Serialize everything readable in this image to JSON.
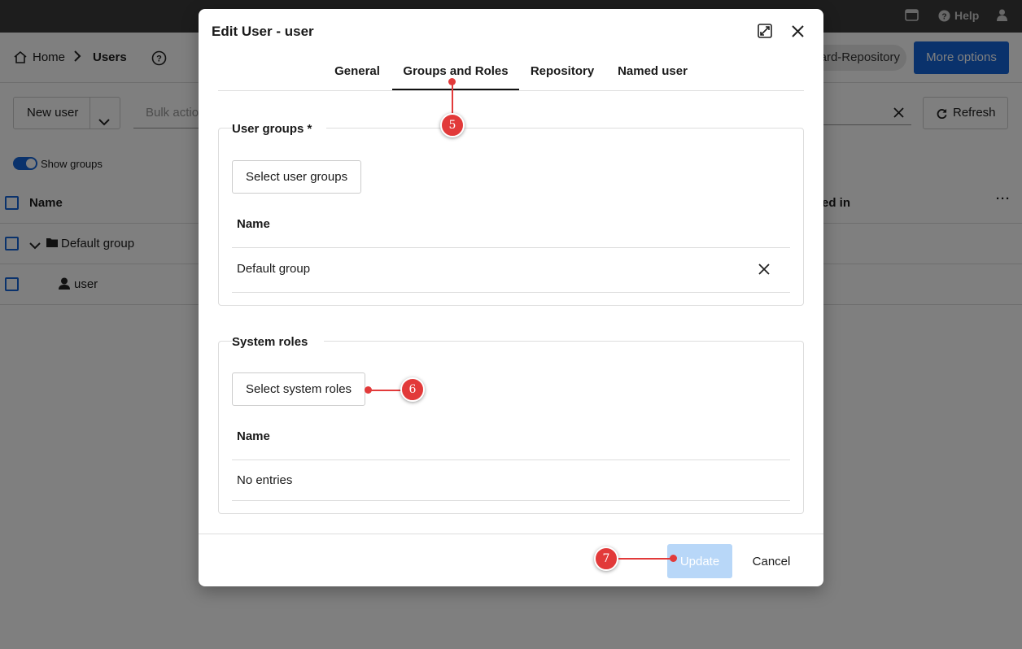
{
  "app": {
    "topbar": {
      "help_label": "Help"
    },
    "breadcrumb": {
      "home": "Home",
      "current": "Users"
    },
    "repository_pill": "ard-Repository",
    "more_options": "More options",
    "toolbar": {
      "new_user": "New user",
      "bulk_actions_placeholder": "Bulk actio",
      "refresh": "Refresh"
    },
    "show_groups_label": "Show groups",
    "table": {
      "name_header": "Name",
      "last_col_header": "ed in",
      "rows": [
        {
          "label": "Default group"
        },
        {
          "label": "user"
        }
      ]
    }
  },
  "dialog": {
    "title": "Edit User - user",
    "tabs": [
      {
        "label": "General"
      },
      {
        "label": "Groups and Roles",
        "active": true
      },
      {
        "label": "Repository"
      },
      {
        "label": "Named user"
      }
    ],
    "user_groups": {
      "legend": "User groups *",
      "select_button": "Select user groups",
      "column_header": "Name",
      "rows": [
        {
          "name": "Default group"
        }
      ]
    },
    "system_roles": {
      "legend": "System roles",
      "select_button": "Select system roles",
      "column_header": "Name",
      "empty_text": "No entries"
    },
    "footer": {
      "update_label": "Update",
      "cancel_label": "Cancel"
    }
  },
  "annotations": [
    {
      "number": "5",
      "target": "Groups and Roles tab"
    },
    {
      "number": "6",
      "target": "Select system roles button"
    },
    {
      "number": "7",
      "target": "Update button"
    }
  ],
  "colors": {
    "accent": "#1565d8",
    "annotation": "#e23a3a",
    "update_disabled": "#b8d7f8"
  }
}
